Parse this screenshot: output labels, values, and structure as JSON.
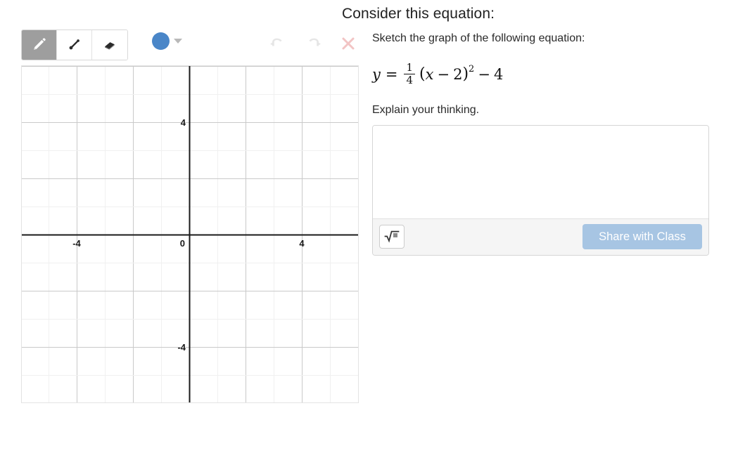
{
  "header": {
    "title": "Consider this equation:"
  },
  "toolbar": {
    "tools": [
      {
        "name": "pencil-tool",
        "label": "Pencil",
        "active": true
      },
      {
        "name": "line-tool",
        "label": "Line",
        "active": false
      },
      {
        "name": "eraser-tool",
        "label": "Eraser",
        "active": false
      }
    ],
    "color": {
      "label": "Blue",
      "hex": "#4a86c8"
    },
    "history": [
      {
        "name": "undo-button",
        "label": "Undo",
        "color": "#e6e6e6"
      },
      {
        "name": "redo-button",
        "label": "Redo",
        "color": "#e6e6e6"
      },
      {
        "name": "clear-button",
        "label": "Clear",
        "color": "#f2c4c4"
      }
    ]
  },
  "graph": {
    "x_labels": [
      {
        "text": "-4",
        "value": -4
      },
      {
        "text": "0",
        "value": 0
      },
      {
        "text": "4",
        "value": 4
      }
    ],
    "y_labels": [
      {
        "text": "4",
        "value": 4
      },
      {
        "text": "-4",
        "value": -4
      }
    ],
    "xlim": [
      -6,
      6
    ],
    "ylim": [
      -6,
      6
    ],
    "minor_step": 1,
    "major_step": 2,
    "minor_color": "#f0f0f0",
    "major_color": "#c9c9c9",
    "axis_color": "#1a1a1a"
  },
  "question": {
    "prompt": "Sketch the graph of the following equation:",
    "equation": {
      "lhs": "y",
      "equals": "=",
      "fraction_numerator": "1",
      "fraction_denominator": "4",
      "open_paren": "(",
      "inner_var": "x",
      "minus": "−",
      "inner_const": "2",
      "close_paren": ")",
      "exponent": "2",
      "tail_minus": "−",
      "tail_const": "4",
      "plain": "y = 1/4 (x − 2)^2 − 4"
    },
    "explain_label": "Explain your thinking.",
    "answer_value": "",
    "answer_placeholder": ""
  },
  "answer_footer": {
    "math_button_label": "Math input",
    "share_label": "Share with Class"
  }
}
